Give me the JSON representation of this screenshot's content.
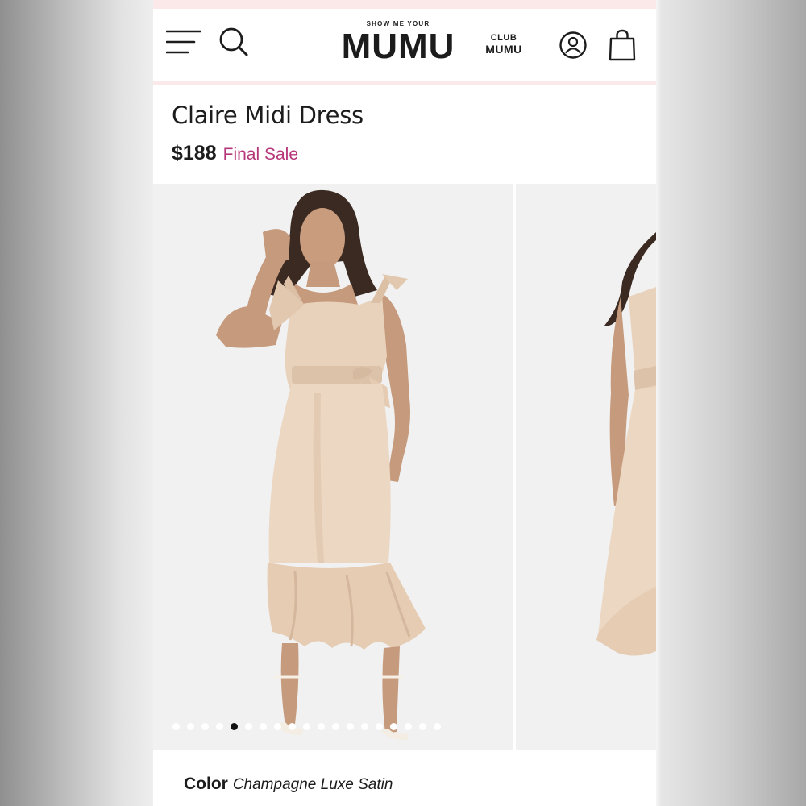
{
  "header": {
    "brand_small": "SHOW ME YOUR",
    "brand_big": "MUMU",
    "club_line1": "CLUB",
    "club_line2": "MUMU",
    "icons": [
      "menu-icon",
      "search-icon",
      "account-icon",
      "shopping-bag-icon"
    ]
  },
  "product": {
    "title": "Claire Midi Dress",
    "price": "$188",
    "sale_label": "Final Sale",
    "sale_color": "#b63679",
    "color_label": "Color",
    "color_value": "Champagne Luxe Satin"
  },
  "gallery": {
    "dot_count": 19,
    "active_index": 4,
    "slide_images": [
      "model-front-photo",
      "model-side-photo"
    ]
  },
  "colors": {
    "accent_strip": "#fbe9e9",
    "text": "#1c1c1c",
    "photo_background": "#f1f1f1",
    "dress": "#e9d2bb"
  }
}
